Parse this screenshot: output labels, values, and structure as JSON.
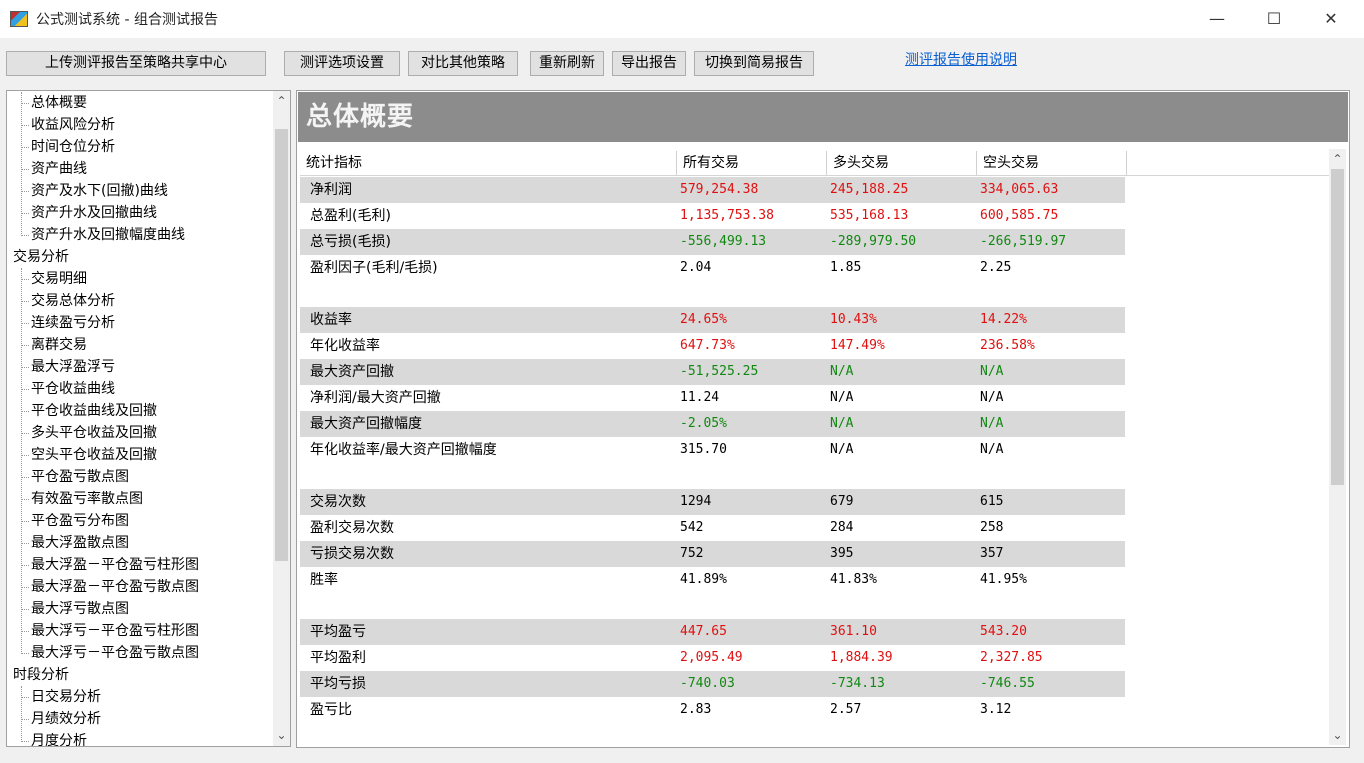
{
  "window": {
    "title": "公式测试系统 - 组合测试报告",
    "minimize": "—",
    "maximize": "☐",
    "close": "✕"
  },
  "toolbar": {
    "upload": "上传测评报告至策略共享中心",
    "options": "测评选项设置",
    "compare": "对比其他策略",
    "refresh": "重新刷新",
    "export": "导出报告",
    "switch": "切换到简易报告",
    "help_link": "测评报告使用说明"
  },
  "tree": {
    "group1_items": [
      "总体概要",
      "收益风险分析",
      "时间仓位分析",
      "资产曲线",
      "资产及水下(回撤)曲线",
      "资产升水及回撤曲线",
      "资产升水及回撤幅度曲线"
    ],
    "group2_label": "交易分析",
    "group2_items": [
      "交易明细",
      "交易总体分析",
      "连续盈亏分析",
      "离群交易",
      "最大浮盈浮亏",
      "平仓收益曲线",
      "平仓收益曲线及回撤",
      "多头平仓收益及回撤",
      "空头平仓收益及回撤",
      "平仓盈亏散点图",
      "有效盈亏率散点图",
      "平仓盈亏分布图",
      "最大浮盈散点图",
      "最大浮盈－平仓盈亏柱形图",
      "最大浮盈－平仓盈亏散点图",
      "最大浮亏散点图",
      "最大浮亏－平仓盈亏柱形图",
      "最大浮亏－平仓盈亏散点图"
    ],
    "group3_label": "时段分析",
    "group3_items": [
      "日交易分析",
      "月绩效分析",
      "月度分析"
    ]
  },
  "section": {
    "title": "总体概要"
  },
  "table": {
    "headers": [
      "统计指标",
      "所有交易",
      "多头交易",
      "空头交易"
    ],
    "rows": [
      {
        "label": "净利润",
        "all": "579,254.38",
        "long": "245,188.25",
        "short": "334,065.63",
        "color": "red"
      },
      {
        "label": "总盈利(毛利)",
        "all": "1,135,753.38",
        "long": "535,168.13",
        "short": "600,585.75",
        "color": "red"
      },
      {
        "label": "总亏损(毛损)",
        "all": "-556,499.13",
        "long": "-289,979.50",
        "short": "-266,519.97",
        "color": "green"
      },
      {
        "label": "盈利因子(毛利/毛损)",
        "all": "2.04",
        "long": "1.85",
        "short": "2.25",
        "color": "black"
      },
      {
        "label": "收益率",
        "all": "24.65%",
        "long": "10.43%",
        "short": "14.22%",
        "color": "red"
      },
      {
        "label": "年化收益率",
        "all": "647.73%",
        "long": "147.49%",
        "short": "236.58%",
        "color": "red"
      },
      {
        "label": "最大资产回撤",
        "all": "-51,525.25",
        "long": "N/A",
        "short": "N/A",
        "color": "green"
      },
      {
        "label": "净利润/最大资产回撤",
        "all": "11.24",
        "long": "N/A",
        "short": "N/A",
        "color": "black"
      },
      {
        "label": "最大资产回撤幅度",
        "all": "-2.05%",
        "long": "N/A",
        "short": "N/A",
        "color": "green"
      },
      {
        "label": "年化收益率/最大资产回撤幅度",
        "all": "315.70",
        "long": "N/A",
        "short": "N/A",
        "color": "black"
      },
      {
        "label": "交易次数",
        "all": "1294",
        "long": "679",
        "short": "615",
        "color": "black"
      },
      {
        "label": "盈利交易次数",
        "all": "542",
        "long": "284",
        "short": "258",
        "color": "black"
      },
      {
        "label": "亏损交易次数",
        "all": "752",
        "long": "395",
        "short": "357",
        "color": "black"
      },
      {
        "label": "胜率",
        "all": "41.89%",
        "long": "41.83%",
        "short": "41.95%",
        "color": "black"
      },
      {
        "label": "平均盈亏",
        "all": "447.65",
        "long": "361.10",
        "short": "543.20",
        "color": "red"
      },
      {
        "label": "平均盈利",
        "all": "2,095.49",
        "long": "1,884.39",
        "short": "2,327.85",
        "color": "red"
      },
      {
        "label": "平均亏损",
        "all": "-740.03",
        "long": "-734.13",
        "short": "-746.55",
        "color": "green"
      },
      {
        "label": "盈亏比",
        "all": "2.83",
        "long": "2.57",
        "short": "3.12",
        "color": "black"
      }
    ]
  }
}
